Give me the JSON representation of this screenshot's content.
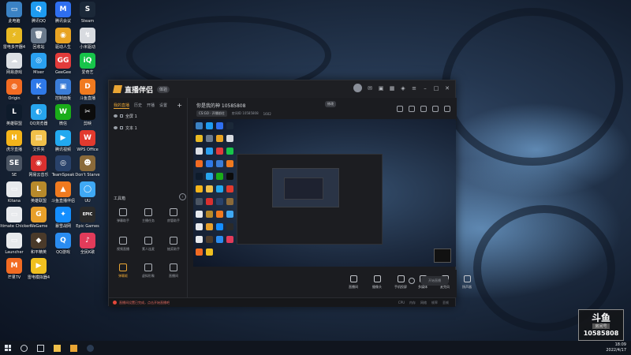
{
  "desktop": {
    "icons": [
      {
        "label": "此电脑",
        "glyph": "▭",
        "color": "#3b82c4"
      },
      {
        "label": "腾讯QQ",
        "glyph": "Q",
        "color": "#1e9bf0"
      },
      {
        "label": "腾讯会议",
        "glyph": "M",
        "color": "#2f6ff0"
      },
      {
        "label": "Steam",
        "glyph": "S",
        "color": "#1b2838"
      },
      {
        "label": "雷电多开器4",
        "glyph": "⚡",
        "color": "#e8b923"
      },
      {
        "label": "回收站",
        "glyph": "🗑",
        "color": "#6b7a8c"
      },
      {
        "label": "驱动人生",
        "glyph": "◉",
        "color": "#e8a323"
      },
      {
        "label": "小米驱动",
        "glyph": "↯",
        "color": "#d8dbe0"
      },
      {
        "label": "网易游戏",
        "glyph": "☁",
        "color": "#dcdfe4"
      },
      {
        "label": "Mixer",
        "glyph": "◎",
        "color": "#2aa0f0"
      },
      {
        "label": "GeeGee",
        "glyph": "GG",
        "color": "#e23b3b"
      },
      {
        "label": "爱奇艺",
        "glyph": "iQ",
        "color": "#17c44a"
      },
      {
        "label": "Origin",
        "glyph": "◍",
        "color": "#f26b22"
      },
      {
        "label": "K",
        "glyph": "K",
        "color": "#2f79e8"
      },
      {
        "label": "控制面板",
        "glyph": "▣",
        "color": "#3b7dd8"
      },
      {
        "label": "斗鱼直播",
        "glyph": "D",
        "color": "#f07a1f"
      },
      {
        "label": "英雄联盟",
        "glyph": "L",
        "color": "#0e1b2b"
      },
      {
        "label": "QQ浏览器",
        "glyph": "◐",
        "color": "#27a5ee"
      },
      {
        "label": "微信",
        "glyph": "W",
        "color": "#1aad19"
      },
      {
        "label": "剪映",
        "glyph": "✂",
        "color": "#0c0c0c"
      },
      {
        "label": "虎牙直播",
        "glyph": "H",
        "color": "#f4b41a"
      },
      {
        "label": "文件夹",
        "glyph": "▤",
        "color": "#f0c04a"
      },
      {
        "label": "腾讯视频",
        "glyph": "▶",
        "color": "#22a9f0"
      },
      {
        "label": "WPS Office",
        "glyph": "W",
        "color": "#e23a2e"
      },
      {
        "label": "SE",
        "glyph": "SE",
        "color": "#4b5563"
      },
      {
        "label": "网易云音乐",
        "glyph": "◉",
        "color": "#d9302f"
      },
      {
        "label": "TeamSpeak",
        "glyph": "◎",
        "color": "#29426a"
      },
      {
        "label": "Don't Starve",
        "glyph": "☻",
        "color": "#8a6a3a"
      },
      {
        "label": "Kitana",
        "glyph": "▭",
        "color": "#e8eaed"
      },
      {
        "label": "英雄联盟",
        "glyph": "L",
        "color": "#b88a2b"
      },
      {
        "label": "斗鱼直播伴侣",
        "glyph": "▲",
        "color": "#f07a1f"
      },
      {
        "label": "UU",
        "glyph": "◯",
        "color": "#3fa9f5"
      },
      {
        "label": "Ultimate Chicken",
        "glyph": "▭",
        "color": "#e8eaed"
      },
      {
        "label": "WeGame",
        "glyph": "G",
        "color": "#e8a02a"
      },
      {
        "label": "暴雪战网",
        "glyph": "✦",
        "color": "#148eff"
      },
      {
        "label": "Epic Games",
        "glyph": "EPIC",
        "color": "#2a2a2a"
      },
      {
        "label": "Launcher",
        "glyph": "▭",
        "color": "#e8eaed"
      },
      {
        "label": "和平精英",
        "glyph": "◆",
        "color": "#4a3a2a"
      },
      {
        "label": "QQ游戏",
        "glyph": "Q",
        "color": "#2a8cf0"
      },
      {
        "label": "全民K歌",
        "glyph": "♪",
        "color": "#e23b5a"
      },
      {
        "label": "芒果TV",
        "glyph": "M",
        "color": "#f26b22"
      },
      {
        "label": "雷电模拟器4",
        "glyph": "▶",
        "color": "#f0c020"
      }
    ]
  },
  "app": {
    "title": "直播伴侣",
    "version": "体验",
    "accent": "#e9a534",
    "left_tabs": [
      "我的直播",
      "历史",
      "开播",
      "设置"
    ],
    "scenes": [
      {
        "name": "全屏 1"
      },
      {
        "name": "文本 1"
      }
    ],
    "toolbox_title": "工具箱",
    "tools": [
      {
        "label": "弹幕助手"
      },
      {
        "label": "主播任务"
      },
      {
        "label": "房管助手"
      },
      {
        "label": "视频直播"
      },
      {
        "label": "素人连麦"
      },
      {
        "label": "抽奖助手"
      },
      {
        "label": "弹幕姬"
      },
      {
        "label": "虚拟形象"
      },
      {
        "label": "直播间"
      }
    ],
    "room": {
      "title": "你是我的神 10585808",
      "pill": "修改",
      "tag": "CS:GO · 开播前往",
      "meta1": "房间ID 10585808",
      "meta2": "1602"
    },
    "bottom_tools": [
      {
        "label": "直播间"
      },
      {
        "label": "摄像头"
      },
      {
        "label": "手机投屏"
      },
      {
        "label": "多媒体"
      },
      {
        "label": "麦克风"
      },
      {
        "label": "扬声器"
      }
    ],
    "live_button": "开始直播",
    "status": {
      "message": "直播间设置已完成，点击开始直播吧",
      "stats": [
        "CPU",
        "内存",
        "网络",
        "帧率",
        "丢帧"
      ]
    }
  },
  "watermark": {
    "logo": "斗鱼",
    "sub": "房间号",
    "room": "10585808"
  },
  "taskbar": {
    "time": "18:09",
    "date": "2022/4/17"
  }
}
